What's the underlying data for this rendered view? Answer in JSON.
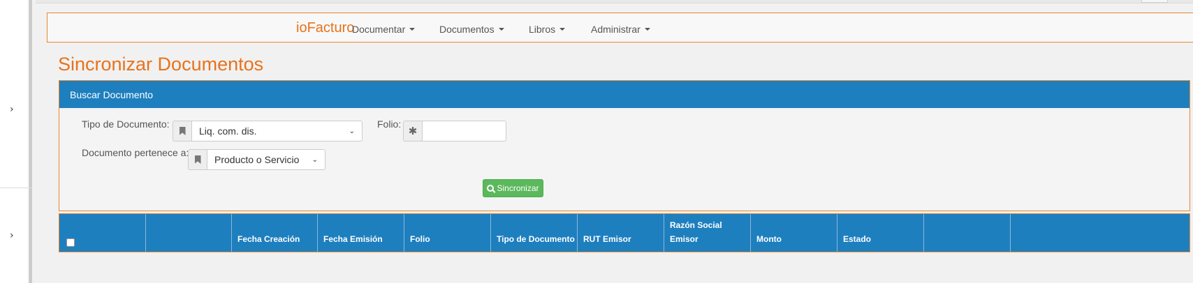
{
  "navbar": {
    "brand": "ioFacturo",
    "items": [
      {
        "label": "Documentar"
      },
      {
        "label": "Documentos"
      },
      {
        "label": "Libros"
      },
      {
        "label": "Administrar"
      }
    ]
  },
  "page": {
    "title": "Sincronizar Documentos"
  },
  "search_panel": {
    "heading": "Buscar Documento",
    "tipo_label": "Tipo de Documento:",
    "tipo_value": "Liq. com. dis.",
    "folio_label": "Folio:",
    "folio_value": "",
    "pertenece_label": "Documento pertenece a:",
    "pertenece_value": "Producto o Servicio",
    "sync_button": "Sincronizar"
  },
  "table": {
    "columns": [
      "",
      "",
      "Fecha Creación",
      "Fecha Emisión",
      "Folio",
      "Tipo de Documento",
      "RUT Emisor",
      "Razón Social Emisor",
      "Monto",
      "Estado",
      "",
      ""
    ]
  },
  "colors": {
    "accent_orange": "#e8721c",
    "header_blue": "#1e7fbf",
    "button_green": "#5cb85c"
  }
}
